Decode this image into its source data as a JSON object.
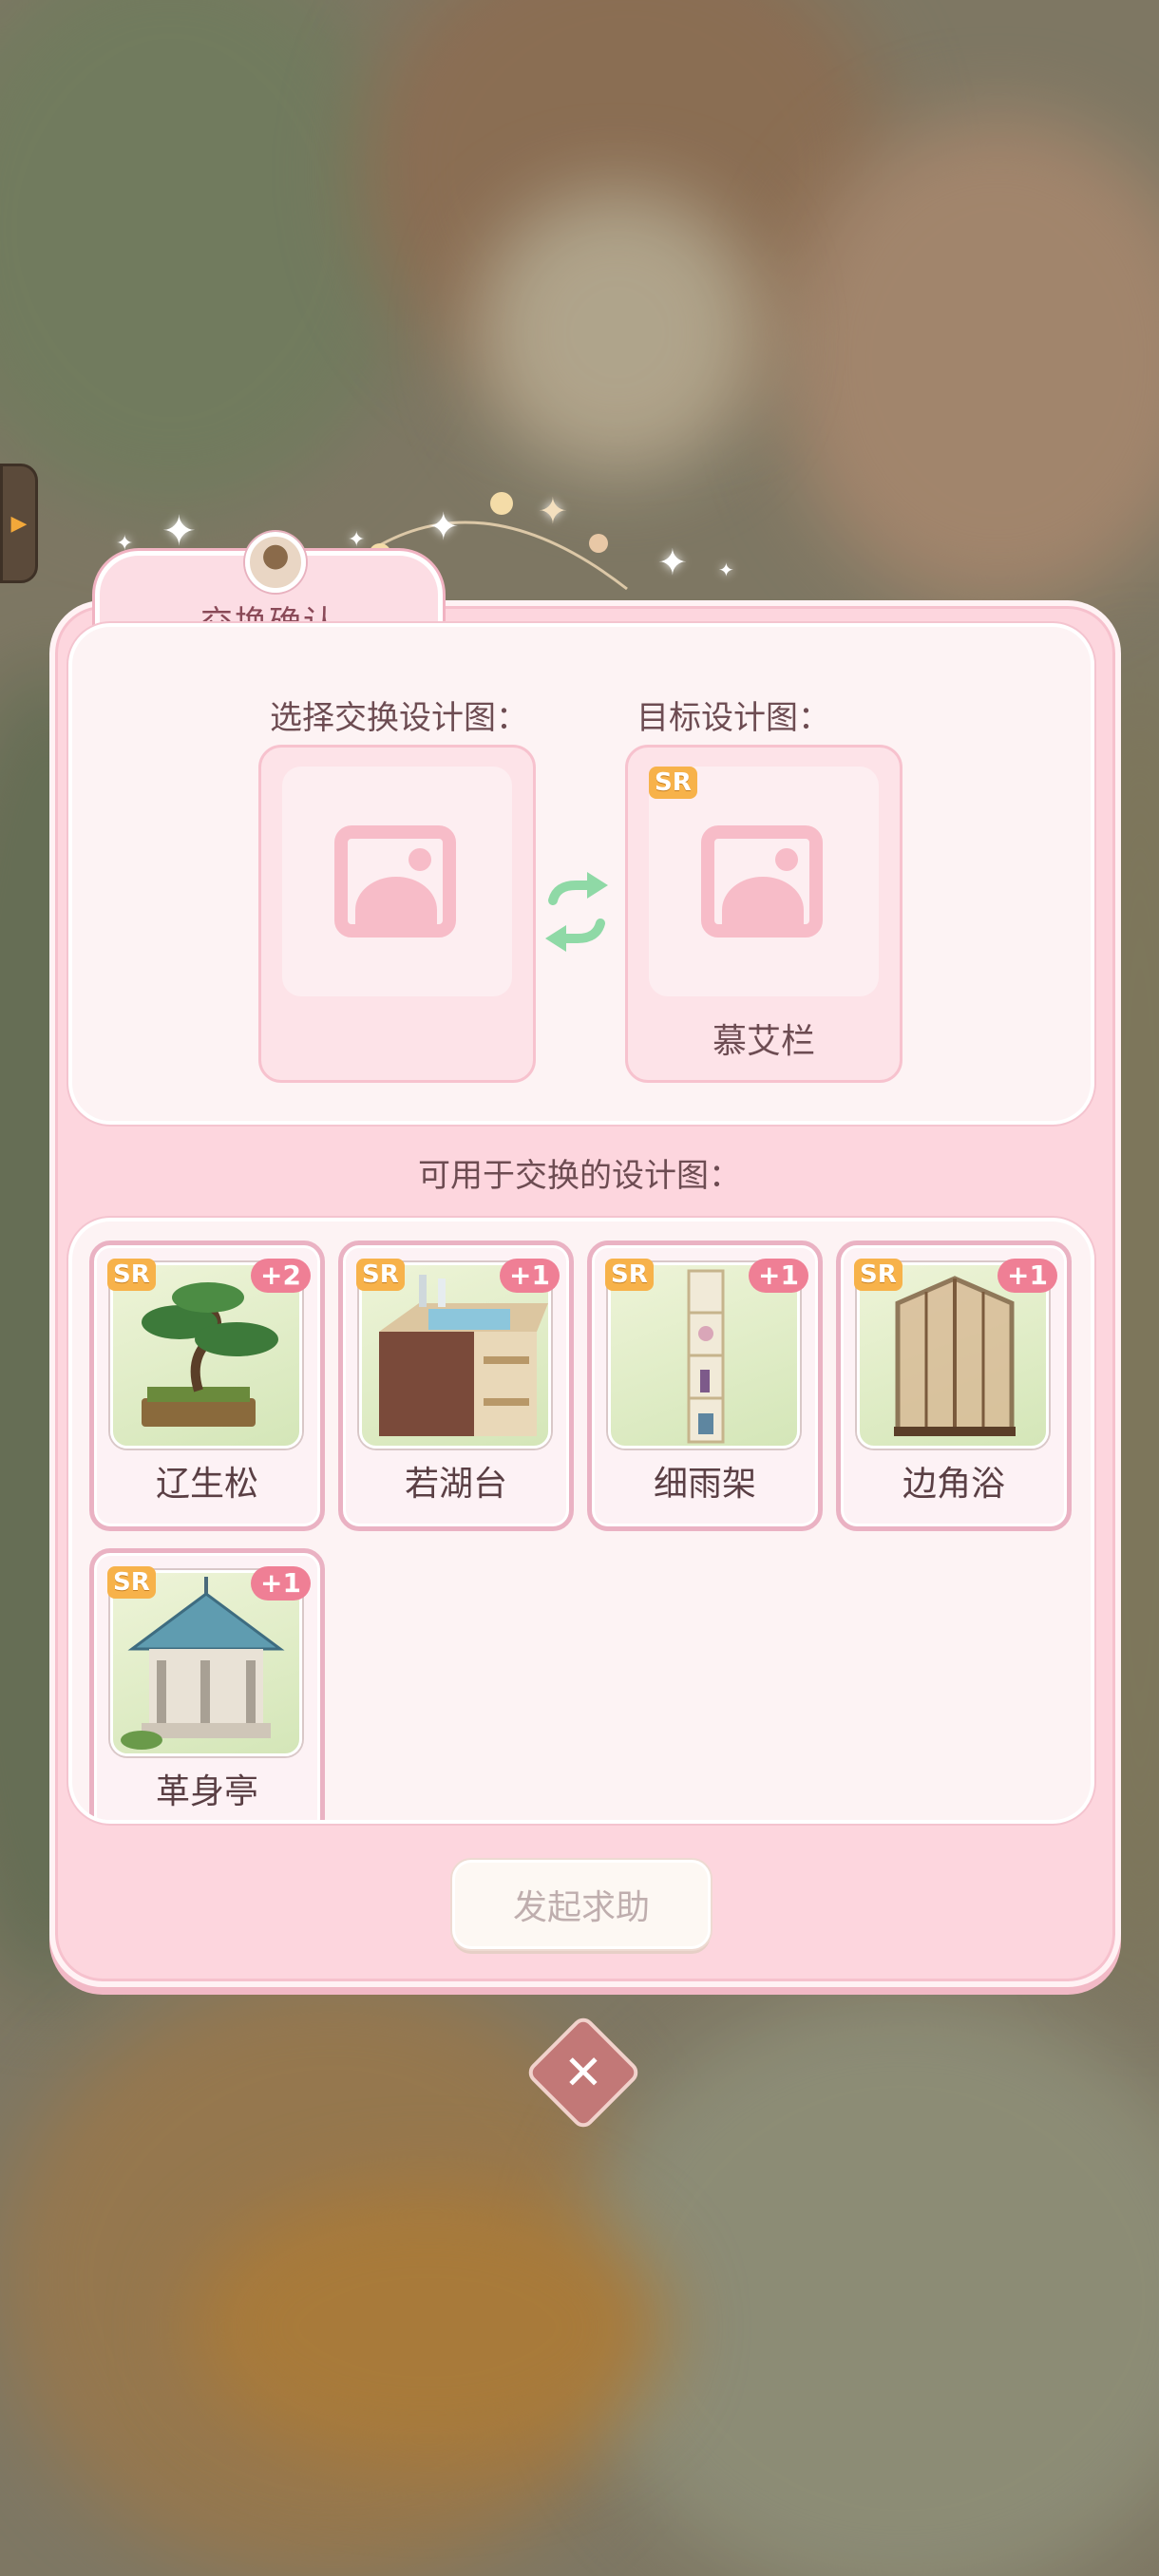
{
  "dialog": {
    "title": "交换确认",
    "select_label": "选择交换设计图：",
    "target_label": "目标设计图：",
    "target_rarity": "SR",
    "target_name": "慕艾栏",
    "available_label": "可用于交换的设计图：",
    "help_button": "发起求助"
  },
  "items": [
    {
      "rarity": "SR",
      "count": "+2",
      "name": "辽生松"
    },
    {
      "rarity": "SR",
      "count": "+1",
      "name": "若湖台"
    },
    {
      "rarity": "SR",
      "count": "+1",
      "name": "细雨架"
    },
    {
      "rarity": "SR",
      "count": "+1",
      "name": "边角浴"
    },
    {
      "rarity": "SR",
      "count": "+1",
      "name": "革身亭"
    }
  ],
  "icons": {
    "placeholder": "image-placeholder-icon",
    "swap": "swap-arrows-icon",
    "close": "close-icon",
    "side": "side-expand-icon"
  },
  "colors": {
    "panel": "#fdd6de",
    "rarity_badge": "#f7b24a",
    "count_badge": "#ef7f95",
    "swap_arrows": "#8fd9a6"
  }
}
